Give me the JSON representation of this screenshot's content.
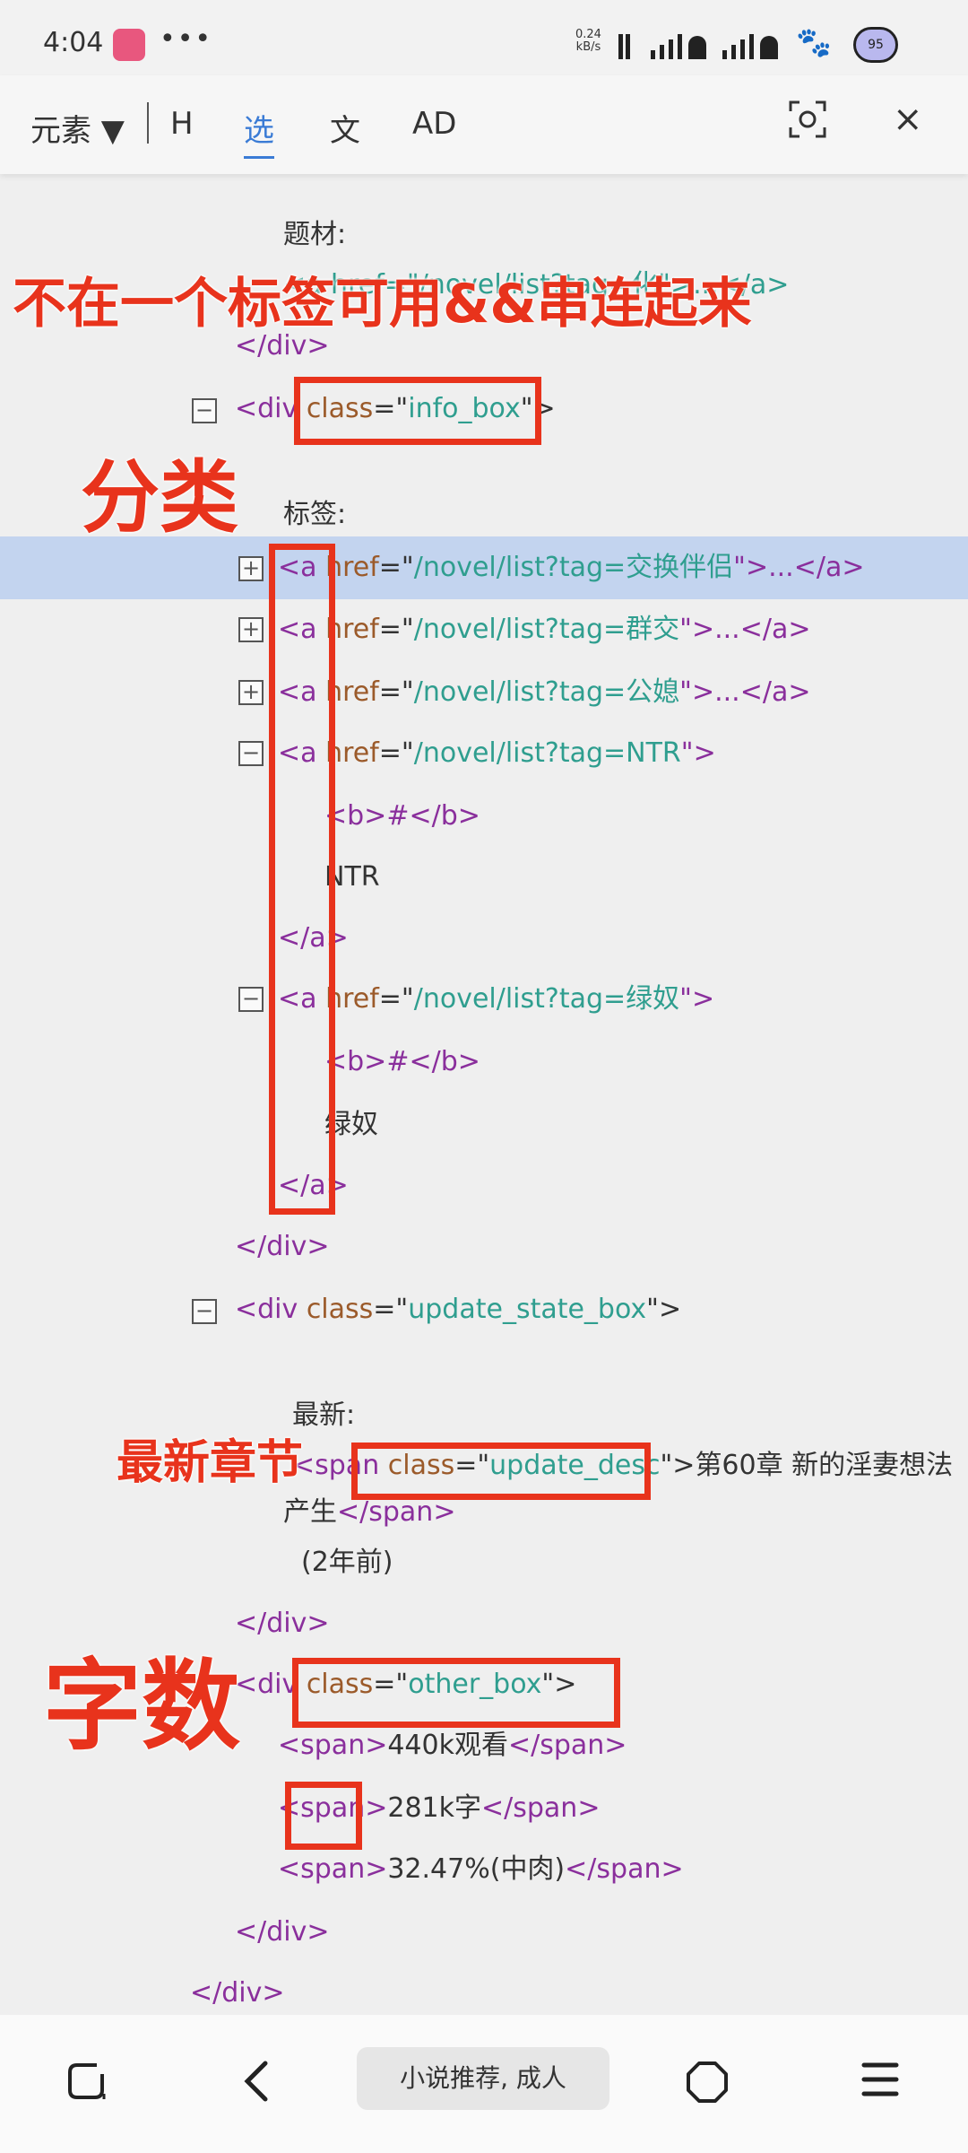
{
  "status_bar": {
    "time": "4:04",
    "dots": "•••",
    "net_speed_value": "0.24",
    "net_speed_unit": "kB/s",
    "battery": "95"
  },
  "toolbar": {
    "element_menu": "元素 ▼",
    "tab_h": "H",
    "tab_select": "选",
    "tab_text": "文",
    "tab_ad": "AD",
    "close": "×"
  },
  "code": {
    "l_theme_label": "题材:",
    "l_theme_link": "<a href=\"/novel/list?tag=化\">...</a>",
    "l_div_close_1": "</div>",
    "l_infobox_open_tag": "<div ",
    "l_infobox_attr": "class",
    "l_infobox_eq": "=\"",
    "l_infobox_val": "info_box",
    "l_infobox_end": "\">",
    "l_tags_label": "标签:",
    "a1": {
      "open": "<a ",
      "attr": "href",
      "eq": "=\"",
      "val": "/novel/list?tag=交换伴侣",
      "end": "\">...</a>"
    },
    "a2": {
      "open": "<a ",
      "attr": "href",
      "eq": "=\"",
      "val": "/novel/list?tag=群交",
      "end": "\">...</a>"
    },
    "a3": {
      "open": "<a ",
      "attr": "href",
      "eq": "=\"",
      "val": "/novel/list?tag=公媳",
      "end": "\">...</a>"
    },
    "a4": {
      "open": "<a ",
      "attr": "href",
      "eq": "=\"",
      "val": "/novel/list?tag=NTR",
      "end": "\">"
    },
    "a4_b": "<b>#</b>",
    "a4_text": "NTR",
    "a4_close": "</a>",
    "a5": {
      "open": "<a ",
      "attr": "href",
      "eq": "=\"",
      "val": "/novel/list?tag=绿奴",
      "end": "\">"
    },
    "a5_b": "<b>#</b>",
    "a5_text": "绿奴",
    "a5_close": "</a>",
    "l_div_close_2": "</div>",
    "update_open": "<div ",
    "update_attr": "class",
    "update_eq": "=\"",
    "update_val": "update_state_box",
    "update_end": "\">",
    "latest_label": "最新:",
    "span_open": "<span ",
    "span_attr": "class",
    "span_eq": "=\"",
    "span_val": "update_desc",
    "span_end": "\">",
    "span_text_1": "第60章 新的淫妻想法",
    "span_text_2": "产生",
    "span_close": "</span>",
    "ago": "(2年前)",
    "l_div_close_3": "</div>",
    "other_open": "<div ",
    "other_attr": "class",
    "other_eq": "=\"",
    "other_val": "other_box",
    "other_end": "\">",
    "s1_open": "<span>",
    "s1_text": "440k观看",
    "s1_close": "</span>",
    "s2_open_lt": "<",
    "s2_open_name": "span",
    "s2_open_gt": ">",
    "s2_text": "281k字",
    "s2_close": "</span>",
    "s3_open": "<span>",
    "s3_text": "32.47%(中肉)",
    "s3_close": "</span>",
    "l_div_close_4": "</div>",
    "l_div_close_5": "</div>"
  },
  "annotations": {
    "top": "不在一个标签可用&&串连起来",
    "category": "分类",
    "latest_chapter": "最新章节",
    "word_count": "字数"
  },
  "navbar": {
    "url": "小说推荐, 成人"
  },
  "colors": {
    "tag": "#8a2f9c",
    "attr": "#9b5a2a",
    "string": "#2f9e8f",
    "annotation_red": "#e8331c",
    "highlight_row": "#c3d4ef",
    "active_tab": "#3a7bd5"
  },
  "icons": {
    "scan": "scan-icon",
    "close": "close-icon",
    "recent_apps": "recent-apps-icon",
    "back": "back-icon",
    "home": "home-icon",
    "menu": "menu-icon",
    "expand": "plus-box-icon",
    "collapse": "minus-box-icon"
  }
}
